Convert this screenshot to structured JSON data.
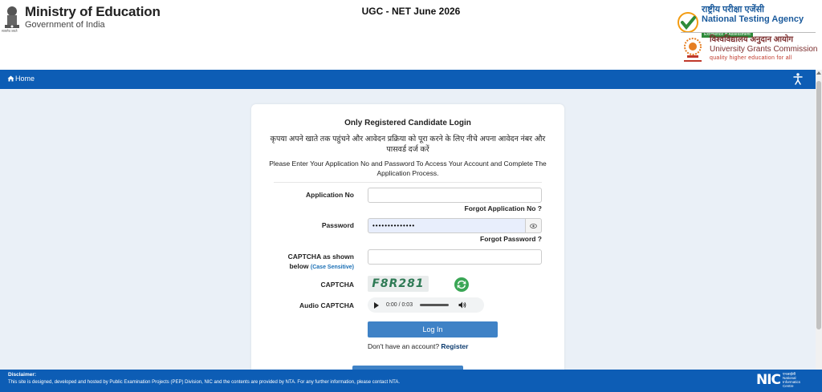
{
  "header": {
    "ministry_title": "Ministry of Education",
    "ministry_subtitle": "Government of India",
    "emblem_motto": "सत्यमेव जयते",
    "exam_title": "UGC - NET June 2026",
    "nta_hindi": "राष्ट्रीय परीक्षा एजेंसी",
    "nta_english": "National Testing Agency",
    "nta_tagline": "Excellence in Assessment",
    "ugc_hindi": "विश्वविद्यालय अनुदान आयोग",
    "ugc_english": "University Grants Commission",
    "ugc_tagline": "quality higher education for all"
  },
  "nav": {
    "home_label": "Home",
    "home_icon": "home-icon",
    "accessibility_icon": "accessibility-icon"
  },
  "login": {
    "title": "Only Registered Candidate Login",
    "instruction_hindi": "कृपया अपने खाते तक पहुंचने और आवेदन प्रक्रिया को पूरा करने के लिए नीचे अपना आवेदन नंबर और पासवर्ड दर्ज करें",
    "instruction_english": "Please Enter Your Application No and Password To Access Your Account and Complete The Application Process.",
    "application_no_label": "Application No",
    "application_no_value": "",
    "forgot_application_label": "Forgot Application No ?",
    "password_label": "Password",
    "password_value": "••••••••••••••",
    "forgot_password_label": "Forgot Password ?",
    "captcha_input_label_1": "CAPTCHA as shown",
    "captcha_input_label_2": "below",
    "captcha_case_note": "(Case Sensitive)",
    "captcha_input_value": "",
    "captcha_label": "CAPTCHA",
    "captcha_text": "F8R281",
    "audio_captcha_label": "Audio CAPTCHA",
    "audio_time": "0:00 / 0:03",
    "login_button": "Log In",
    "signup_prompt": "Don't have an account?",
    "register_link": "Register"
  },
  "footer": {
    "disclaimer_title": "Disclaimer:",
    "disclaimer_text": "This site is designed, developed and hosted by Public Examination Projects (PEP) Division, NIC and the contents are provided by NTA. For any further information, please contact NTA.",
    "nic_logo": "NIC",
    "nic_hindi": "एनआईसी",
    "nic_line1": "National",
    "nic_line2": "Informatics",
    "nic_line3": "Centre"
  },
  "colors": {
    "primary_blue": "#0d5db5",
    "button_blue": "#3f82c6",
    "nta_green": "#2e8b3a",
    "captcha_green": "#2f7a55"
  }
}
